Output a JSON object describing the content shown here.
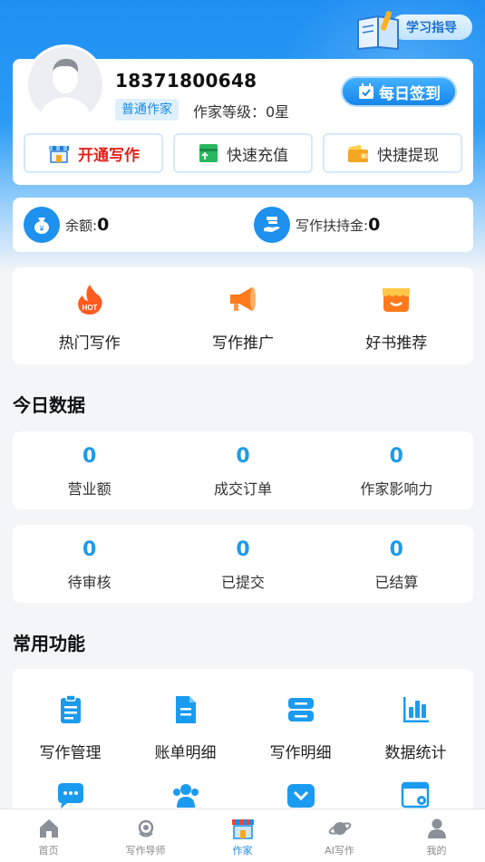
{
  "header": {
    "guide_label": "学习指导"
  },
  "profile": {
    "phone": "18371800648",
    "role_tag": "普通作家",
    "level_text": "作家等级：0星",
    "signin_label": "每日签到"
  },
  "quick_actions": [
    {
      "label": "开通写作",
      "icon": "shop-icon"
    },
    {
      "label": "快速充值",
      "icon": "card-icon"
    },
    {
      "label": "快捷提现",
      "icon": "wallet-icon"
    }
  ],
  "balance": {
    "balance_label": "余额:",
    "balance_value": "0",
    "fund_label": "写作扶持金:",
    "fund_value": "0"
  },
  "features": [
    {
      "label": "热门写作",
      "icon": "hot-fire-icon"
    },
    {
      "label": "写作推广",
      "icon": "megaphone-icon"
    },
    {
      "label": "好书推荐",
      "icon": "store-awning-icon"
    }
  ],
  "today": {
    "title": "今日数据",
    "row1": [
      {
        "value": "0",
        "label": "营业额"
      },
      {
        "value": "0",
        "label": "成交订单"
      },
      {
        "value": "0",
        "label": "作家影响力"
      }
    ],
    "row2": [
      {
        "value": "0",
        "label": "待审核"
      },
      {
        "value": "0",
        "label": "已提交"
      },
      {
        "value": "0",
        "label": "已结算"
      }
    ]
  },
  "tools": {
    "title": "常用功能",
    "items": [
      {
        "label": "写作管理",
        "icon": "clipboard-icon"
      },
      {
        "label": "账单明细",
        "icon": "document-icon"
      },
      {
        "label": "写作明细",
        "icon": "list-detail-icon"
      },
      {
        "label": "数据统计",
        "icon": "bar-chart-icon"
      }
    ]
  },
  "tabbar": [
    {
      "label": "首页",
      "icon": "home-icon",
      "active": false
    },
    {
      "label": "写作导师",
      "icon": "headset-icon",
      "active": false
    },
    {
      "label": "作家",
      "icon": "storefront-icon",
      "active": true
    },
    {
      "label": "AI写作",
      "icon": "planet-icon",
      "active": false
    },
    {
      "label": "我的",
      "icon": "user-icon",
      "active": false
    }
  ],
  "colors": {
    "primary": "#1e8be8",
    "accent_red": "#e0241c",
    "stat_blue": "#1e9be9"
  }
}
